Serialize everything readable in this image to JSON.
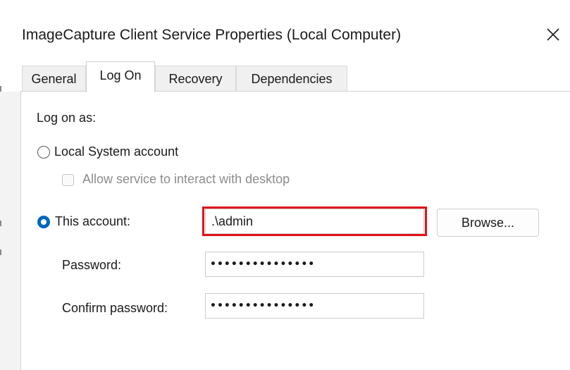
{
  "window": {
    "title": "ImageCapture Client Service Properties (Local Computer)"
  },
  "tabs": [
    {
      "label": "General",
      "active": false
    },
    {
      "label": "Log On",
      "active": true
    },
    {
      "label": "Recovery",
      "active": false
    },
    {
      "label": "Dependencies",
      "active": false
    }
  ],
  "logon": {
    "heading": "Log on as:",
    "local_system": {
      "label": "Local System account",
      "selected": false
    },
    "interact_desktop": {
      "label": "Allow service to interact with desktop",
      "checked": false,
      "enabled": false
    },
    "this_account": {
      "label": "This account:",
      "selected": true,
      "value": ".\\admin"
    },
    "browse_label": "Browse...",
    "password": {
      "label": "Password:",
      "value": "•••••••••••••••"
    },
    "confirm_password": {
      "label": "Confirm password:",
      "value": "•••••••••••••••"
    }
  },
  "colors": {
    "accent": "#0067c0",
    "highlight_box": "#e0121b"
  }
}
